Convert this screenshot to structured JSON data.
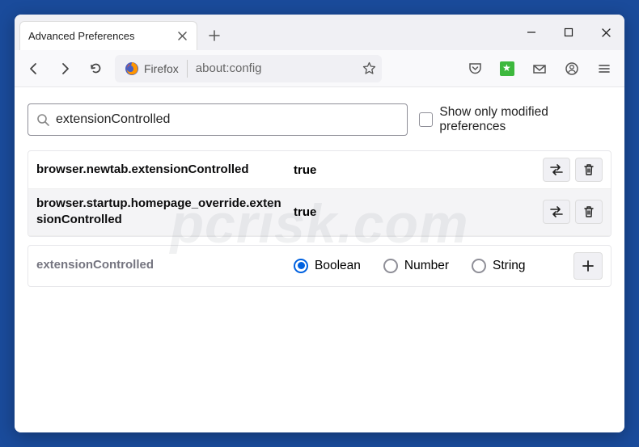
{
  "window": {
    "tab_title": "Advanced Preferences"
  },
  "toolbar": {
    "identity_label": "Firefox",
    "url": "about:config"
  },
  "search": {
    "value": "extensionControlled",
    "modified_only_label": "Show only modified preferences"
  },
  "prefs": [
    {
      "name": "browser.newtab.extensionControlled",
      "value": "true"
    },
    {
      "name": "browser.startup.homepage_override.extensionControlled",
      "value": "true"
    }
  ],
  "new_pref": {
    "name": "extensionControlled",
    "types": [
      "Boolean",
      "Number",
      "String"
    ],
    "selected": "Boolean"
  },
  "watermark": "pcrisk.com"
}
